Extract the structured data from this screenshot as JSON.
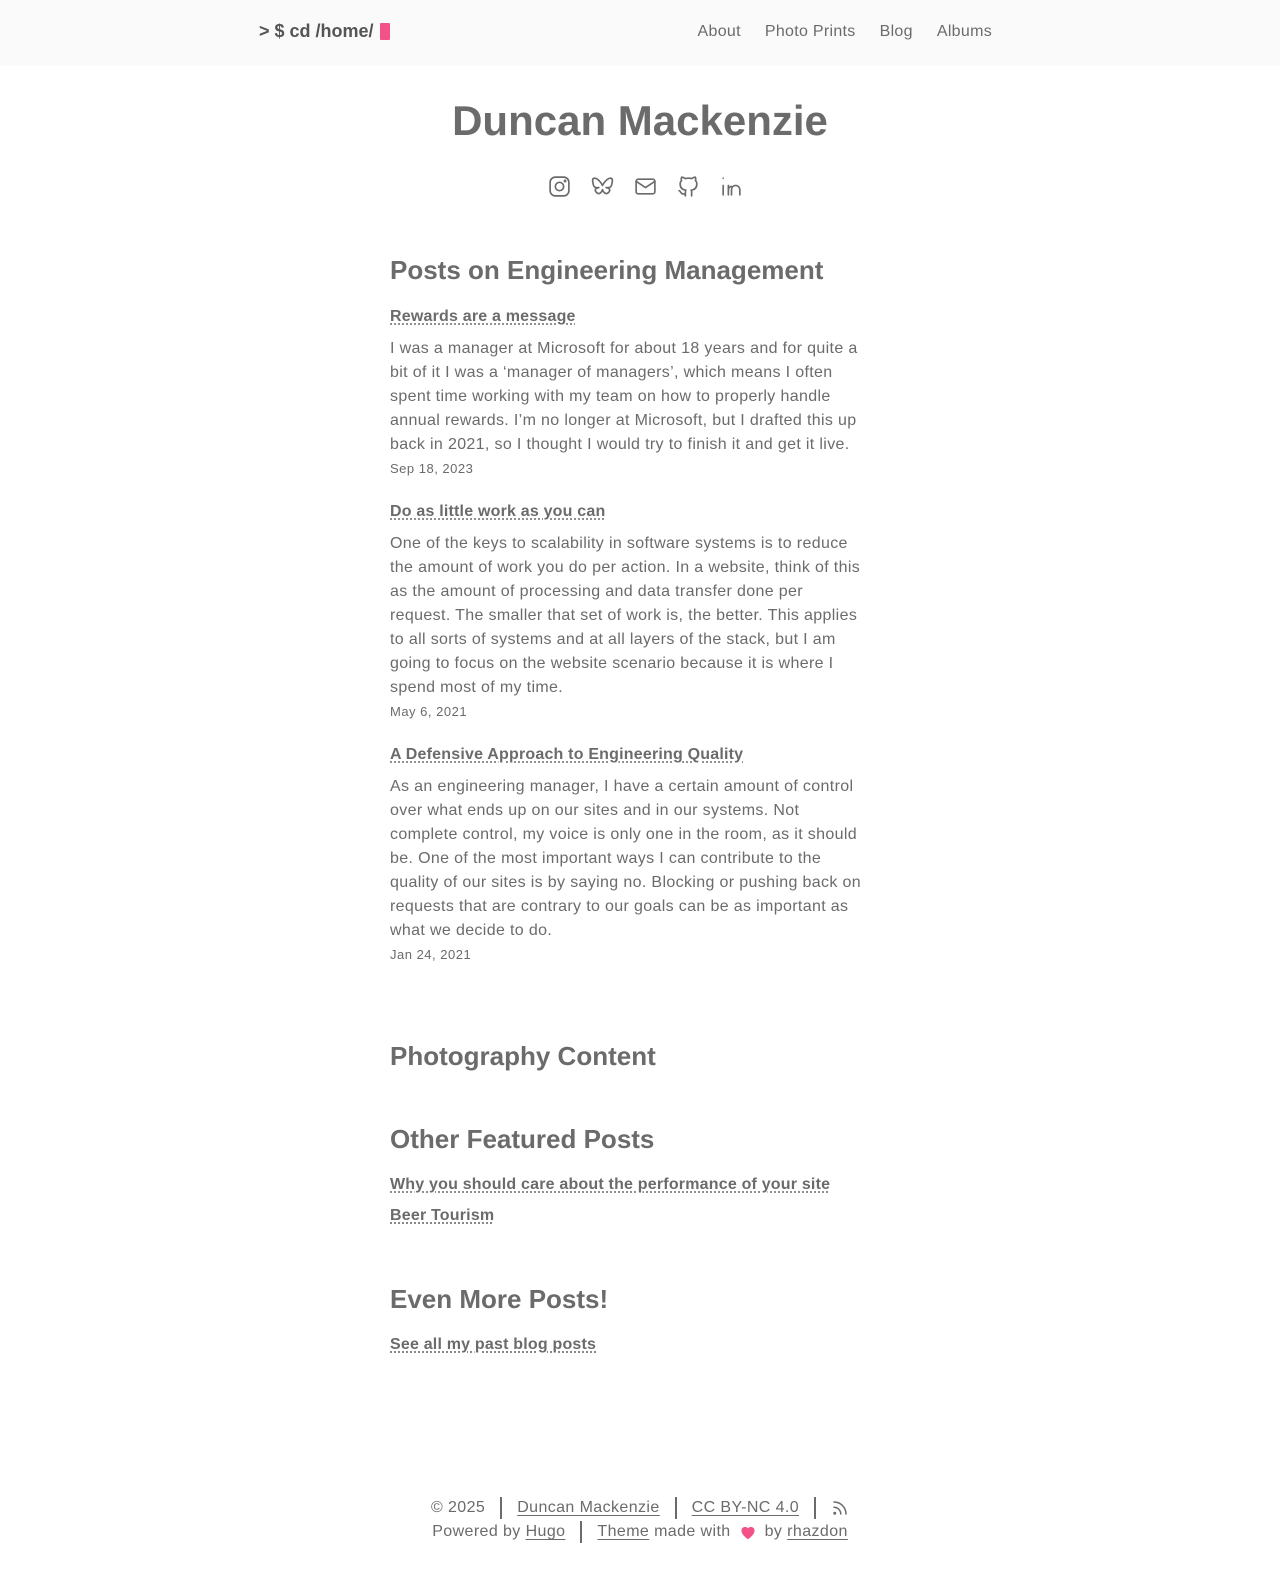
{
  "header": {
    "brand": "> $ cd /home/",
    "nav": [
      "About",
      "Photo Prints",
      "Blog",
      "Albums"
    ]
  },
  "hero": {
    "name": "Duncan Mackenzie",
    "socials": [
      "instagram-icon",
      "bluesky-icon",
      "mail-icon",
      "github-icon",
      "linkedin-icon"
    ]
  },
  "sections": {
    "engineering": "Posts on Engineering Management",
    "photography": "Photography Content",
    "featured": "Other Featured Posts",
    "more": "Even More Posts!"
  },
  "posts": [
    {
      "title": "Rewards are a message",
      "summary": "I was a manager at Microsoft for about 18 years and for quite a bit of it I was a ‘manager of managers’, which means I often spent time working with my team on how to properly handle annual rewards. I’m no longer at Microsoft, but I drafted this up back in 2021, so I thought I would try to finish it and get it live.",
      "date": "Sep 18, 2023"
    },
    {
      "title": "Do as little work as you can",
      "summary": "One of the keys to scalability in software systems is to reduce the amount of work you do per action. In a website, think of this as the amount of processing and data transfer done per request. The smaller that set of work is, the better. This applies to all sorts of systems and at all layers of the stack, but I am going to focus on the website scenario because it is where I spend most of my time.",
      "date": "May 6, 2021"
    },
    {
      "title": "A Defensive Approach to Engineering Quality",
      "summary": "As an engineering manager, I have a certain amount of control over what ends up on our sites and in our systems. Not complete control, my voice is only one in the room, as it should be. One of the most important ways I can contribute to the quality of our sites is by saying no. Blocking or pushing back on requests that are contrary to our goals can be as important as what we decide to do.",
      "date": "Jan 24, 2021"
    }
  ],
  "featured_posts": [
    "Why you should care about the performance of your site",
    "Beer Tourism"
  ],
  "more_posts": [
    "See all my past blog posts"
  ],
  "footer": {
    "copyright": "© 2025",
    "author": "Duncan Mackenzie",
    "license": "CC BY-NC 4.0",
    "powered_by": "Powered by",
    "hugo": "Hugo",
    "theme": "Theme",
    "made_with": "made with",
    "by": "by",
    "theme_author": "rhazdon"
  },
  "colors": {
    "text": "#6b6b6b",
    "accent": "#f25287",
    "header_bg": "#fafafa"
  }
}
